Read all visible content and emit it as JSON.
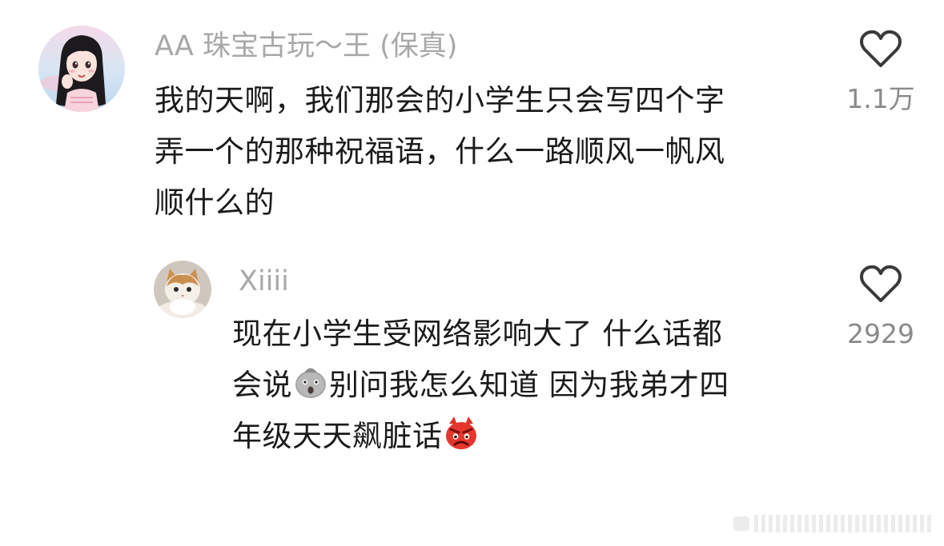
{
  "comments": [
    {
      "username": "AA 珠宝古玩～王 (保真)",
      "text_lines": [
        "我的天啊，我们那会的小学生只会写四个字",
        "弄一个的那种祝福语，什么一路顺风一帆风",
        "顺什么的"
      ],
      "like_count": "1.1万",
      "avatar": "cartoon-girl-avatar",
      "like_icon": "heart-outline-icon"
    },
    {
      "username": "Xiiii",
      "text_lines": [
        "现在小学生受网络影响大了 什么话都",
        {
          "before": "会说",
          "emoji": "shocked-face-emoji",
          "after": "别问我怎么知道 因为我弟才四"
        },
        {
          "before": "年级天天飙脏话",
          "emoji": "angry-devil-emoji",
          "after": ""
        }
      ],
      "like_count": "2929",
      "avatar": "fluffy-cat-avatar",
      "like_icon": "heart-outline-icon"
    }
  ],
  "colors": {
    "username": "#a8a8a8",
    "text": "#1b1b1b",
    "like_count": "#8a8a8a",
    "heart_stroke": "#3a3a3a"
  }
}
